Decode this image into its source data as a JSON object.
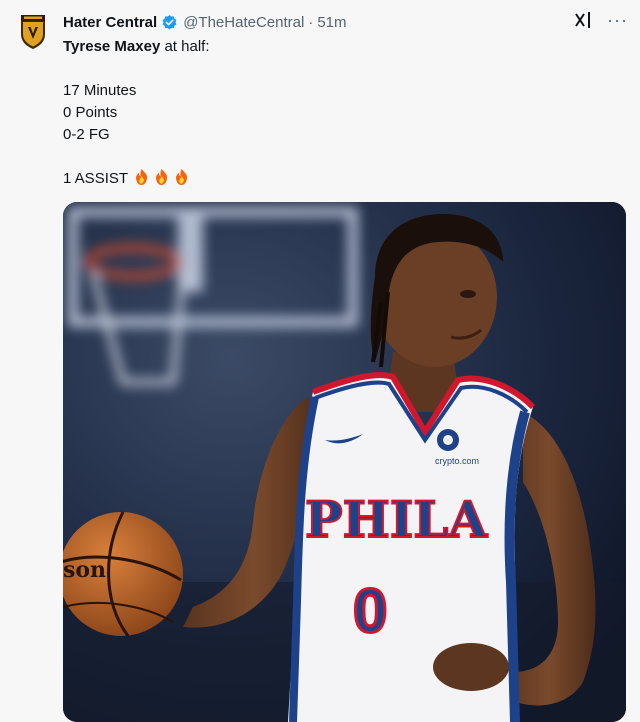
{
  "tweet": {
    "display_name": "Hater Central",
    "handle": "@TheHateCentral",
    "separator": "·",
    "time": "51m",
    "text_line1_bold": "Tyrese Maxey",
    "text_line1_rest": " at half:",
    "stat_minutes": "17 Minutes",
    "stat_points": "0 Points",
    "stat_fg": "0-2 FG",
    "stat_assist": "1 ASSIST"
  },
  "media": {
    "jersey_text": "PHILA",
    "jersey_number": "0",
    "sponsor": "crypto.com",
    "ball_text": "son"
  },
  "icons": {
    "avatar": "team-logo-icon",
    "verified": "verified-badge-icon",
    "grok": "grok-icon",
    "more": "more-icon",
    "fire": "fire-emoji-icon"
  },
  "colors": {
    "verified_blue": "#1d9bf0",
    "jersey_red": "#d0172e",
    "jersey_blue": "#1d428a"
  }
}
